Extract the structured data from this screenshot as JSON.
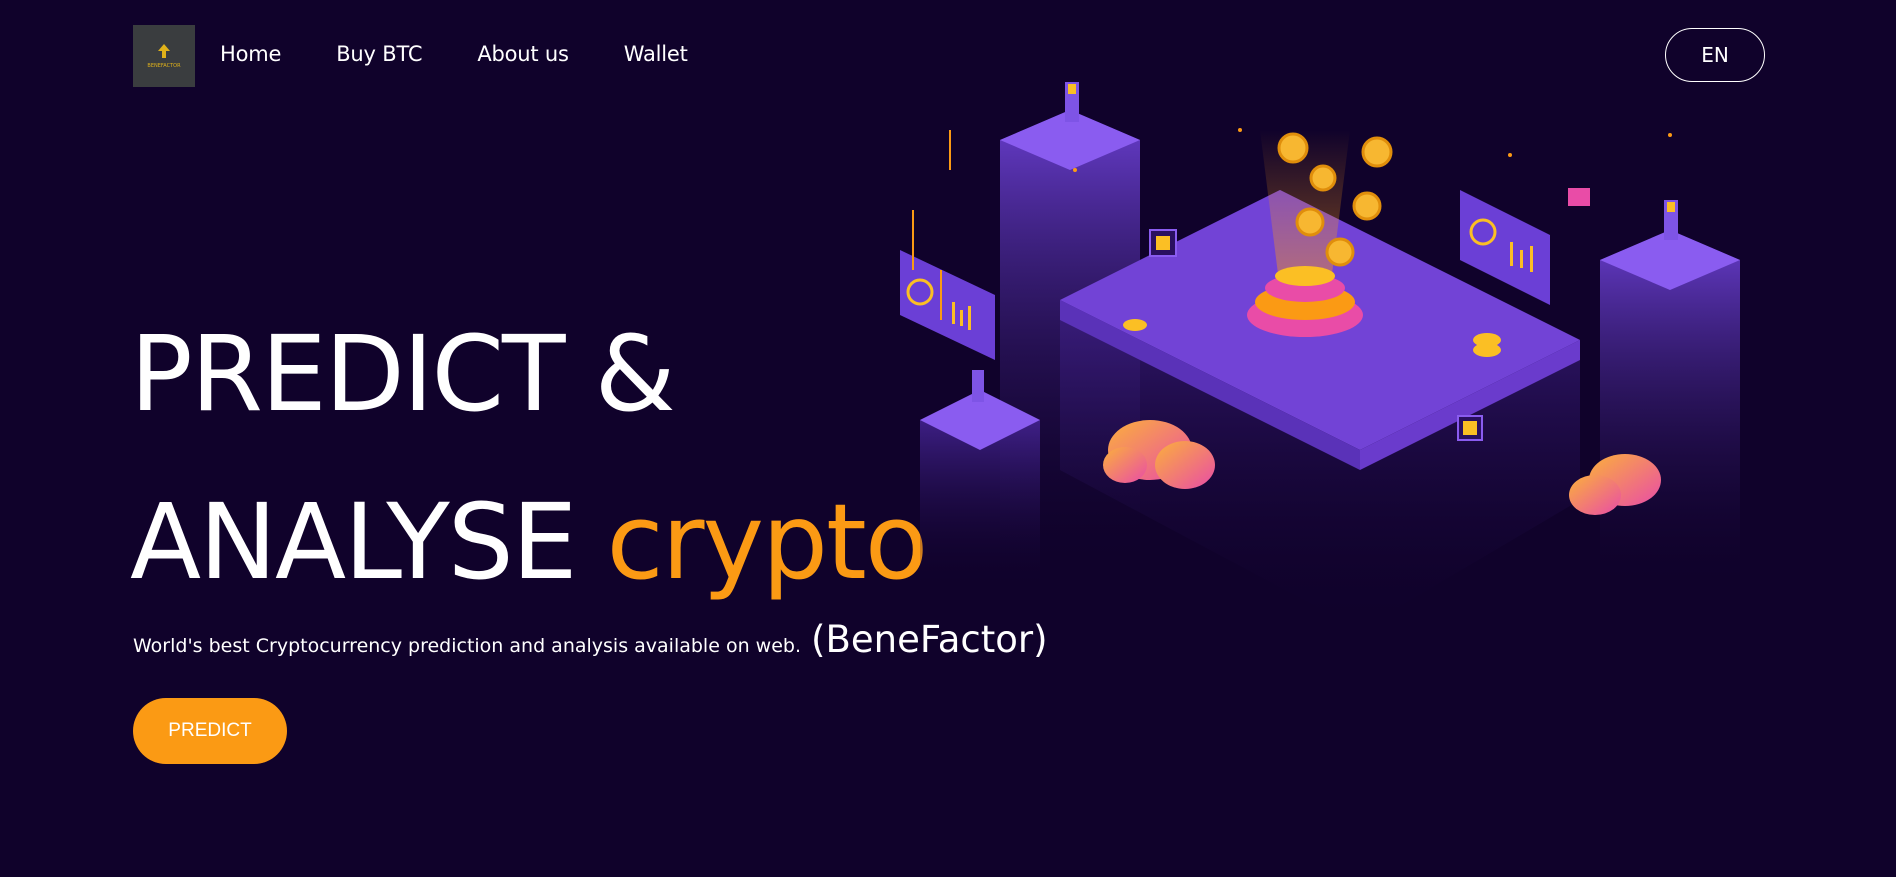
{
  "logo": {
    "text": "BENEFACTOR"
  },
  "nav": {
    "links": [
      "Home",
      "Buy BTC",
      "About us",
      "Wallet"
    ],
    "lang": "EN"
  },
  "hero": {
    "line1": "PREDICT &",
    "line2": "ANALYSE",
    "accent": "crypto",
    "subtitle": "World's best Cryptocurrency prediction and analysis available on web.",
    "brand": "(BeneFactor)",
    "cta": "PREDICT"
  },
  "colors": {
    "background": "#10022b",
    "accent": "#fb9a14",
    "purple": "#7243d6",
    "logo_bg": "#3a3d3f"
  }
}
